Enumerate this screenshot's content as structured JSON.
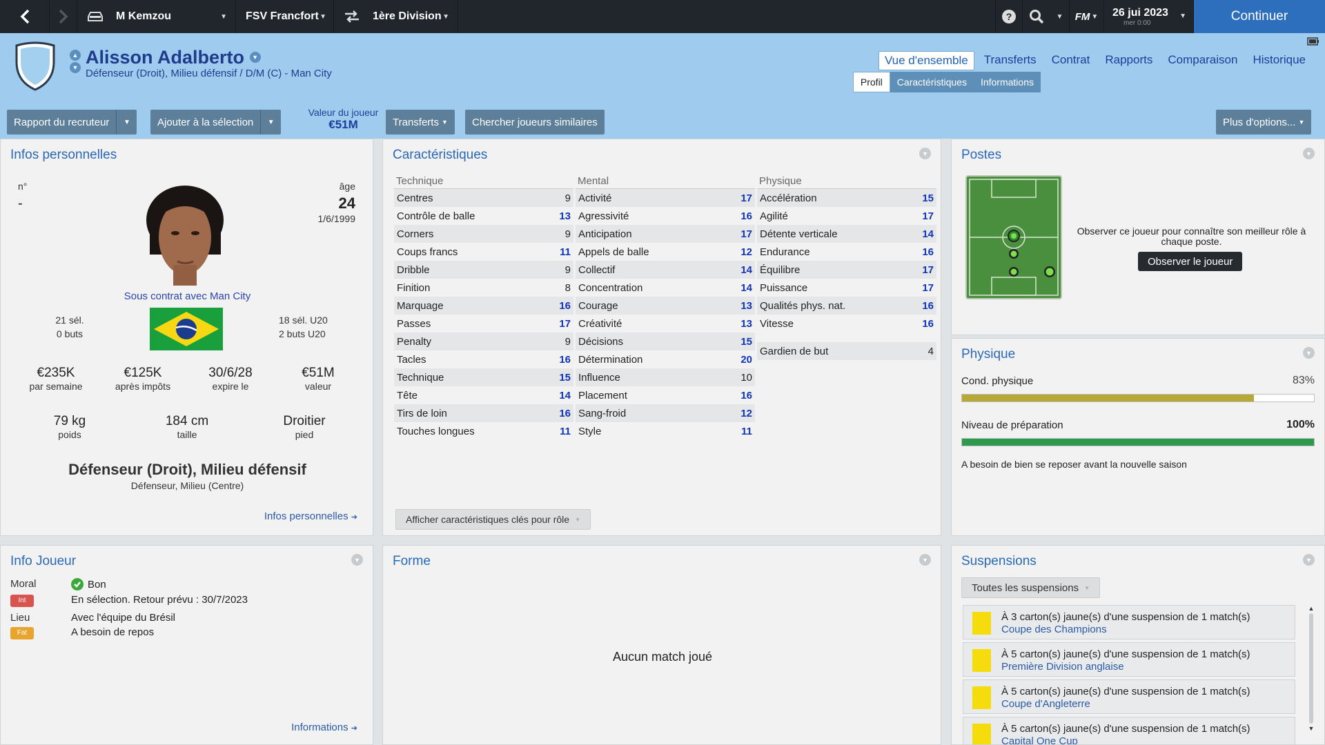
{
  "topbar": {
    "manager": "M Kemzou",
    "club": "FSV Francfort",
    "competition": "1ère Division",
    "date": "26 jui 2023",
    "date_sub": "mer 0:00",
    "continue_label": "Continuer",
    "fm_label": "FM"
  },
  "player": {
    "name": "Alisson Adalberto",
    "subtitle": "Défenseur (Droit), Milieu défensif / D/M (C) - Man City"
  },
  "nav_tabs": [
    "Vue d'ensemble",
    "Transferts",
    "Contrat",
    "Rapports",
    "Comparaison",
    "Historique"
  ],
  "sub_tabs": [
    "Profil",
    "Caractéristiques",
    "Informations"
  ],
  "toolbar": {
    "scout_report": "Rapport du recruteur",
    "add_selection": "Ajouter à la sélection",
    "value_label": "Valeur du joueur",
    "value": "€51M",
    "transfers": "Transferts",
    "similar": "Chercher joueurs similaires",
    "more_options": "Plus d'options..."
  },
  "personal": {
    "title": "Infos personnelles",
    "number_label": "n°",
    "number": "-",
    "age_label": "âge",
    "age": "24",
    "dob": "1/6/1999",
    "contract": "Sous contrat avec Man City",
    "caps": "21 sél.",
    "goals": "0 buts",
    "u20_caps": "18 sél. U20",
    "u20_goals": "2 buts U20",
    "wage": "€235K",
    "wage_label": "par semaine",
    "after_tax": "€125K",
    "after_tax_label": "après impôts",
    "expires": "30/6/28",
    "expires_label": "expire le",
    "value": "€51M",
    "value_label": "valeur",
    "weight": "79 kg",
    "weight_label": "poids",
    "height": "184 cm",
    "height_label": "taille",
    "foot": "Droitier",
    "foot_label": "pied",
    "position_main": "Défenseur (Droit), Milieu défensif",
    "position_sub": "Défenseur, Milieu (Centre)",
    "link": "Infos personnelles"
  },
  "attributes": {
    "title": "Caractéristiques",
    "technique_label": "Technique",
    "mental_label": "Mental",
    "physique_label": "Physique",
    "technique": [
      {
        "name": "Centres",
        "value": "9",
        "hi": false
      },
      {
        "name": "Contrôle de balle",
        "value": "13",
        "hi": true
      },
      {
        "name": "Corners",
        "value": "9",
        "hi": false
      },
      {
        "name": "Coups francs",
        "value": "11",
        "hi": true
      },
      {
        "name": "Dribble",
        "value": "9",
        "hi": false
      },
      {
        "name": "Finition",
        "value": "8",
        "hi": false
      },
      {
        "name": "Marquage",
        "value": "16",
        "hi": true
      },
      {
        "name": "Passes",
        "value": "17",
        "hi": true
      },
      {
        "name": "Penalty",
        "value": "9",
        "hi": false
      },
      {
        "name": "Tacles",
        "value": "16",
        "hi": true
      },
      {
        "name": "Technique",
        "value": "15",
        "hi": true
      },
      {
        "name": "Tête",
        "value": "14",
        "hi": true
      },
      {
        "name": "Tirs de loin",
        "value": "16",
        "hi": true
      },
      {
        "name": "Touches longues",
        "value": "11",
        "hi": true
      }
    ],
    "mental": [
      {
        "name": "Activité",
        "value": "17",
        "hi": true
      },
      {
        "name": "Agressivité",
        "value": "16",
        "hi": true
      },
      {
        "name": "Anticipation",
        "value": "17",
        "hi": true
      },
      {
        "name": "Appels de balle",
        "value": "12",
        "hi": true
      },
      {
        "name": "Collectif",
        "value": "14",
        "hi": true
      },
      {
        "name": "Concentration",
        "value": "14",
        "hi": true
      },
      {
        "name": "Courage",
        "value": "13",
        "hi": true
      },
      {
        "name": "Créativité",
        "value": "13",
        "hi": true
      },
      {
        "name": "Décisions",
        "value": "15",
        "hi": true
      },
      {
        "name": "Détermination",
        "value": "20",
        "hi": true
      },
      {
        "name": "Influence",
        "value": "10",
        "hi": false
      },
      {
        "name": "Placement",
        "value": "16",
        "hi": true
      },
      {
        "name": "Sang-froid",
        "value": "12",
        "hi": true
      },
      {
        "name": "Style",
        "value": "11",
        "hi": true
      }
    ],
    "physique": [
      {
        "name": "Accélération",
        "value": "15",
        "hi": true
      },
      {
        "name": "Agilité",
        "value": "17",
        "hi": true
      },
      {
        "name": "Détente verticale",
        "value": "14",
        "hi": true
      },
      {
        "name": "Endurance",
        "value": "16",
        "hi": true
      },
      {
        "name": "Équilibre",
        "value": "17",
        "hi": true
      },
      {
        "name": "Puissance",
        "value": "17",
        "hi": true
      },
      {
        "name": "Qualités phys. nat.",
        "value": "16",
        "hi": true
      },
      {
        "name": "Vitesse",
        "value": "16",
        "hi": true
      }
    ],
    "goalkeeper_name": "Gardien de but",
    "goalkeeper_value": "4",
    "role_button": "Afficher caractéristiques clés pour rôle"
  },
  "positions": {
    "title": "Postes",
    "text": "Observer ce joueur pour connaître son meilleur rôle à chaque poste.",
    "button": "Observer le joueur"
  },
  "physical": {
    "title": "Physique",
    "condition_label": "Cond. physique",
    "condition": "83%",
    "condition_fraction": 0.83,
    "readiness_label": "Niveau de préparation",
    "readiness": "100%",
    "readiness_fraction": 1.0,
    "note": "A besoin de bien se reposer avant la nouvelle saison",
    "condition_color": "#b8a937",
    "readiness_color": "#2e9a4e"
  },
  "info": {
    "title": "Info Joueur",
    "moral_label": "Moral",
    "moral_value": "Bon",
    "int_badge": "Int",
    "int_text": "En sélection. Retour prévu : 30/7/2023",
    "lieu_label": "Lieu",
    "lieu_value": "Avec l'équipe du Brésil",
    "fat_badge": "Fat",
    "fat_text": "A besoin de repos",
    "link": "Informations"
  },
  "form": {
    "title": "Forme",
    "empty": "Aucun match joué"
  },
  "suspensions": {
    "title": "Suspensions",
    "filter": "Toutes les suspensions",
    "items": [
      {
        "text": "À 3 carton(s) jaune(s) d'une suspension de 1 match(s)",
        "competition": "Coupe des Champions"
      },
      {
        "text": "À 5 carton(s) jaune(s) d'une suspension de 1 match(s)",
        "competition": "Première Division anglaise"
      },
      {
        "text": "À 5 carton(s) jaune(s) d'une suspension de 1 match(s)",
        "competition": "Coupe d'Angleterre"
      },
      {
        "text": "À 5 carton(s) jaune(s) d'une suspension de 1 match(s)",
        "competition": "Capital One Cup"
      }
    ]
  }
}
